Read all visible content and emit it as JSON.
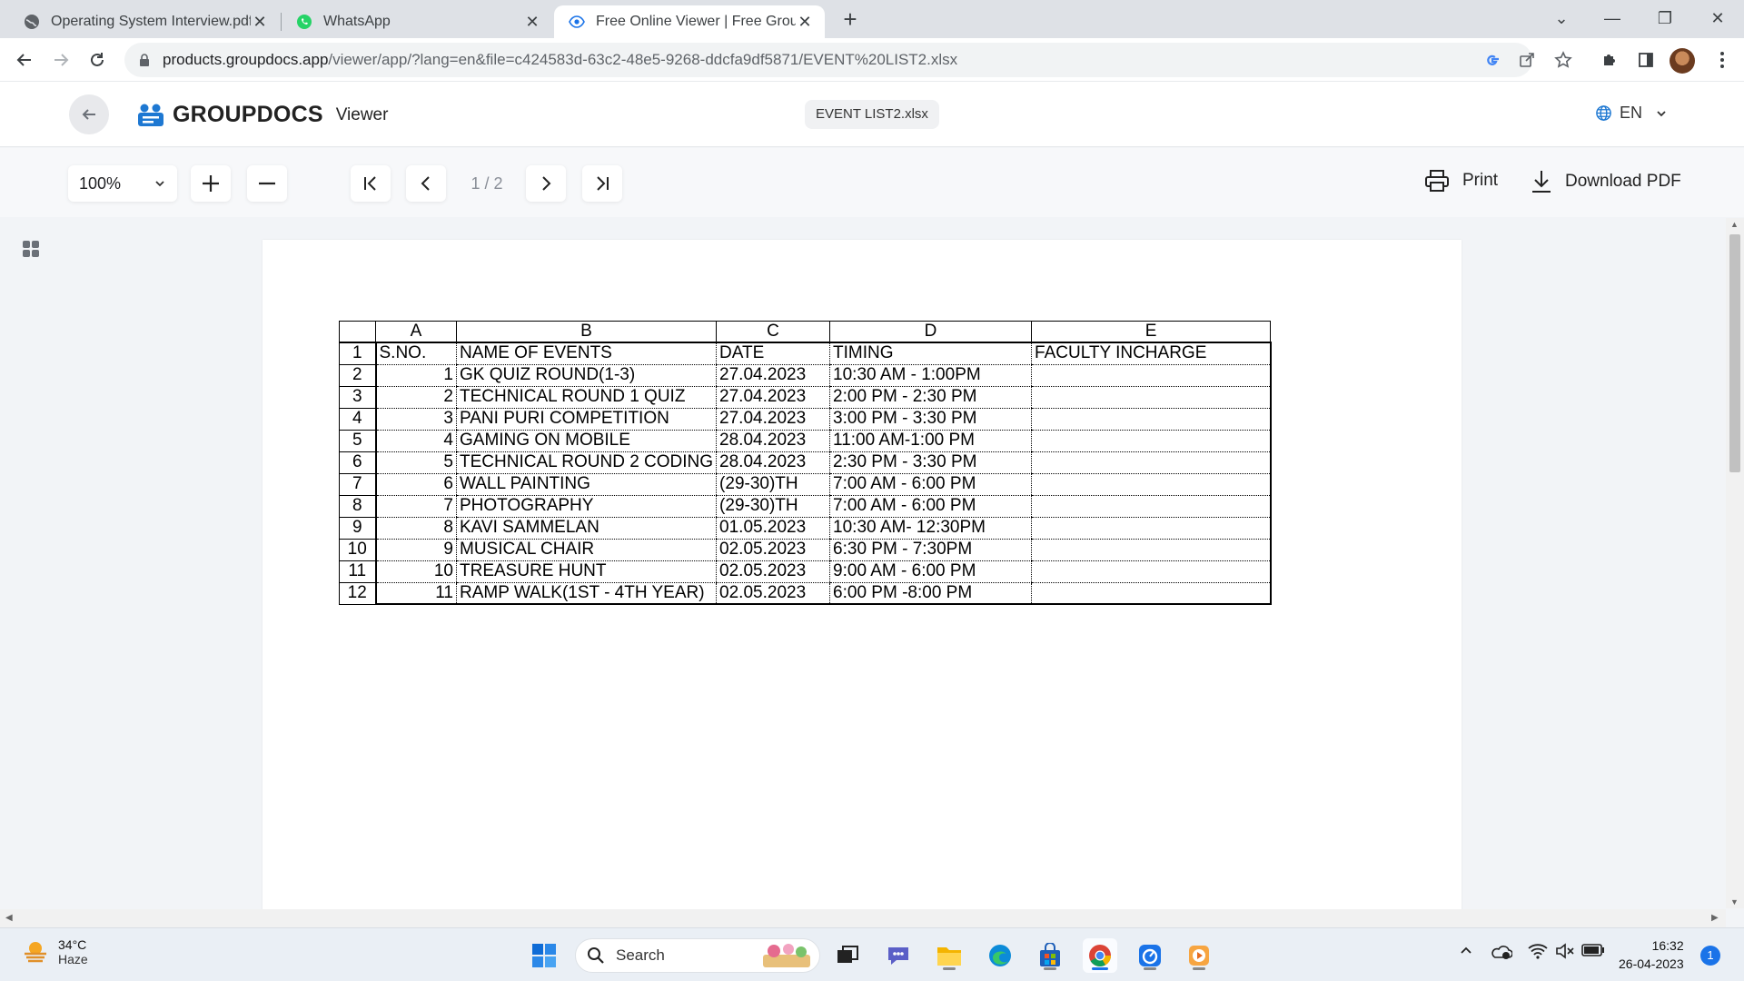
{
  "browser": {
    "tabs": [
      {
        "title": "Operating System Interview.pdf",
        "icon": "globe-icon"
      },
      {
        "title": "WhatsApp",
        "icon": "whatsapp-icon"
      },
      {
        "title": "Free Online Viewer | Free GroupDocs",
        "icon": "eye-icon"
      }
    ],
    "url_host": "products.groupdocs.app",
    "url_path": "/viewer/app/?lang=en&file=c424583d-63c2-48e5-9268-ddcfa9df5871/EVENT%20LIST2.xlsx"
  },
  "app": {
    "brand": "GROUPDOCS",
    "product": "Viewer",
    "file_name": "EVENT LIST2.xlsx",
    "language": "EN",
    "zoom": "100%",
    "page_indicator": "1 / 2",
    "print_label": "Print",
    "download_label": "Download PDF"
  },
  "sheet": {
    "columns": [
      "A",
      "B",
      "C",
      "D",
      "E"
    ],
    "rows": [
      {
        "n": "1",
        "a": "S.NO.",
        "b": "NAME OF EVENTS",
        "c": "DATE",
        "d": "TIMING",
        "e": "FACULTY INCHARGE"
      },
      {
        "n": "2",
        "a": "1",
        "b": "GK QUIZ ROUND(1-3)",
        "c": "27.04.2023",
        "d": "10:30 AM - 1:00PM",
        "e": ""
      },
      {
        "n": "3",
        "a": "2",
        "b": "TECHNICAL ROUND 1 QUIZ",
        "c": "27.04.2023",
        "d": "2:00 PM - 2:30 PM",
        "e": ""
      },
      {
        "n": "4",
        "a": "3",
        "b": "PANI PURI COMPETITION",
        "c": "27.04.2023",
        "d": "3:00 PM - 3:30 PM",
        "e": ""
      },
      {
        "n": "5",
        "a": "4",
        "b": "GAMING ON MOBILE",
        "c": "28.04.2023",
        "d": "11:00 AM-1:00 PM",
        "e": ""
      },
      {
        "n": "6",
        "a": "5",
        "b": "TECHNICAL ROUND 2 CODING",
        "c": "28.04.2023",
        "d": "2:30 PM - 3:30 PM",
        "e": ""
      },
      {
        "n": "7",
        "a": "6",
        "b": "WALL PAINTING",
        "c": "(29-30)TH",
        "d": "7:00 AM - 6:00 PM",
        "e": ""
      },
      {
        "n": "8",
        "a": "7",
        "b": "PHOTOGRAPHY",
        "c": "(29-30)TH",
        "d": "7:00 AM - 6:00 PM",
        "e": ""
      },
      {
        "n": "9",
        "a": "8",
        "b": "KAVI SAMMELAN",
        "c": "01.05.2023",
        "d": "10:30 AM- 12:30PM",
        "e": ""
      },
      {
        "n": "10",
        "a": "9",
        "b": "MUSICAL CHAIR",
        "c": "02.05.2023",
        "d": "6:30 PM - 7:30PM",
        "e": ""
      },
      {
        "n": "11",
        "a": "10",
        "b": "TREASURE HUNT",
        "c": "02.05.2023",
        "d": "9:00 AM - 6:00 PM",
        "e": ""
      },
      {
        "n": "12",
        "a": "11",
        "b": "RAMP WALK(1ST - 4TH YEAR)",
        "c": "02.05.2023",
        "d": "6:00 PM -8:00 PM",
        "e": ""
      }
    ]
  },
  "taskbar": {
    "weather_temp": "34°C",
    "weather_desc": "Haze",
    "search_label": "Search",
    "time": "16:32",
    "date": "26-04-2023",
    "notifications": "1"
  },
  "colors": {
    "brand_blue": "#1e78d2",
    "chrome_blue": "#1a73e8"
  }
}
